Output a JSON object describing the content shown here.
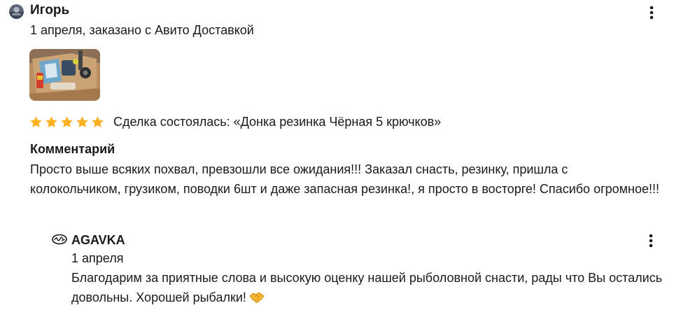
{
  "review": {
    "author_name": "Игорь",
    "date_text": "1 апреля, заказано с Авито Доставкой",
    "rating": 5,
    "rating_max": 5,
    "deal_text": "Сделка состоялась: «Донка резинка Чёрная 5 крючков»",
    "comment_heading": "Комментарий",
    "comment_text": "Просто выше всяких похвал, превзошли все ожидания!!! Заказал снасть, резинку, пришла с колокольчиком, грузиком, поводки 6шт и даже запасная резинка!, я просто в восторге! Спасибо огромное!!!"
  },
  "reply": {
    "shop_name": "AGAVKA",
    "date_text": "1 апреля",
    "text": "Благодарим за приятные слова и высокую оценку нашей рыболовной снасти, рады что Вы остались довольны. Хорошей рыбалки!",
    "emoji_icon": "handshake-icon"
  },
  "icons": {
    "avatar": "user-avatar",
    "menu": "more-vertical-icon",
    "star": "star-icon",
    "shop_logo": "shop-logo-icon"
  },
  "colors": {
    "star": "#ffb021",
    "text": "#1a1a1a",
    "emoji": "#f5b735"
  }
}
